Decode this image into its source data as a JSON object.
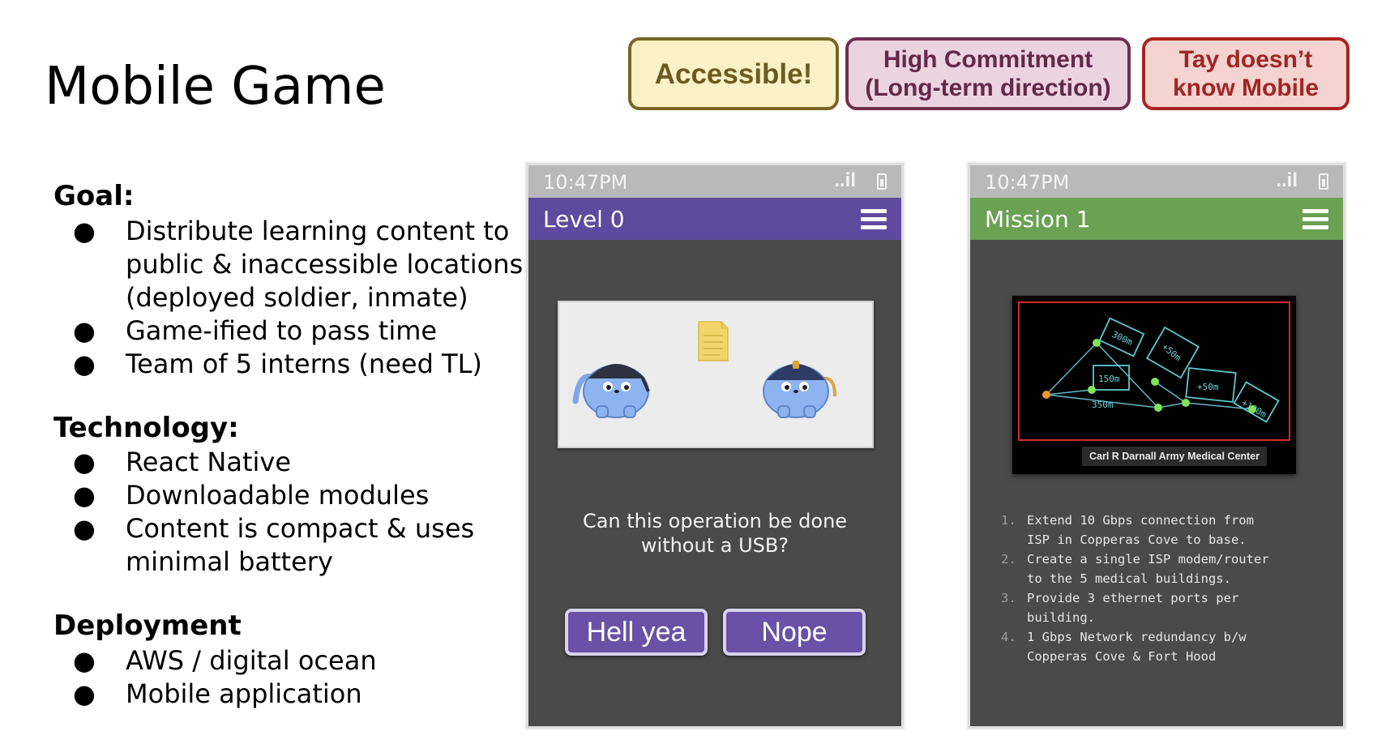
{
  "slide": {
    "title": "Mobile Game",
    "badges": {
      "accessible": "Accessible!",
      "commitment_line1": "High Commitment",
      "commitment_line2": "(Long-term direction)",
      "mobile_line1": "Tay doesn’t",
      "mobile_line2": "know Mobile"
    },
    "colors": {
      "accessible": "#fbf1c7",
      "commitment": "#ecd3e0",
      "mobile": "#f4d3d1"
    }
  },
  "sections": {
    "goal": {
      "heading": "Goal:",
      "items": [
        {
          "lines": [
            "Distribute learning content to",
            "public & inaccessible locations",
            "(deployed soldier, inmate)"
          ]
        },
        {
          "lines": [
            "Game-ified to pass time"
          ]
        },
        {
          "lines": [
            "Team of 5 interns (need TL)"
          ]
        }
      ]
    },
    "technology": {
      "heading": "Technology:",
      "items": [
        {
          "lines": [
            "React Native"
          ]
        },
        {
          "lines": [
            "Downloadable modules"
          ]
        },
        {
          "lines": [
            "Content is compact & uses",
            "minimal battery"
          ]
        }
      ]
    },
    "deployment": {
      "heading": "Deployment",
      "items": [
        {
          "lines": [
            "AWS / digital ocean"
          ]
        },
        {
          "lines": [
            "Mobile application"
          ]
        }
      ]
    },
    "bullet": "●"
  },
  "phone1": {
    "status_time": "10:47PM",
    "signal": "..il",
    "header_title": "Level 0",
    "header_color": "#5e4a9e",
    "question_line1": "Can this operation be done",
    "question_line2": "without a USB?",
    "answer_yes": "Hell yea",
    "answer_no": "Nope",
    "icons": [
      "menu-icon",
      "battery-icon",
      "document-icon"
    ]
  },
  "phone2": {
    "status_time": "10:47PM",
    "signal": "..il",
    "header_title": "Mission 1",
    "header_color": "#6aa153",
    "map": {
      "caption": "Carl R Darnall Army Medical Center",
      "labels": [
        "300m",
        "+50m",
        "150m",
        "+50m",
        "+100m",
        "350m"
      ]
    },
    "steps": [
      {
        "n": "1.",
        "lines": [
          "Extend 10 Gbps connection from",
          "ISP in Copperas Cove to base."
        ]
      },
      {
        "n": "2.",
        "lines": [
          "Create a single ISP modem/router",
          "to the 5 medical buildings."
        ]
      },
      {
        "n": "3.",
        "lines": [
          "Provide 3 ethernet ports per",
          "building."
        ]
      },
      {
        "n": "4.",
        "lines": [
          "1 Gbps Network redundancy b/w",
          "Copperas Cove & Fort Hood"
        ]
      }
    ]
  }
}
